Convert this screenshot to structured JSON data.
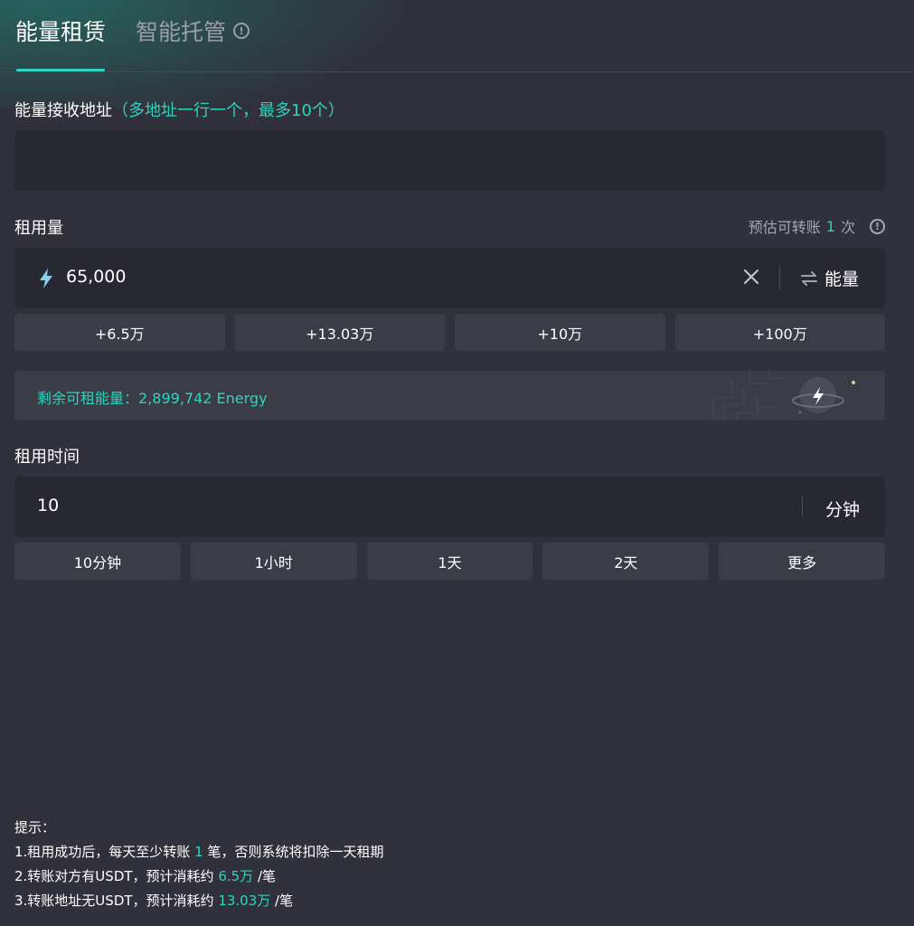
{
  "tabs": {
    "active": "能量租赁",
    "inactive": "智能托管",
    "info_icon": "info-circle-icon"
  },
  "address": {
    "label": "能量接收地址",
    "hint": "（多地址一行一个，最多10个）",
    "value": ""
  },
  "amount": {
    "label": "租用量",
    "estimate_prefix": "预估可转账",
    "estimate_count": "1",
    "estimate_suffix": "次",
    "value": "65,000",
    "unit": "能量",
    "icons": {
      "lead": "lightning-bolt-icon",
      "clear": "close-icon",
      "toggle": "swap-icon"
    },
    "quick": [
      "+6.5万",
      "+13.03万",
      "+10万",
      "+100万"
    ]
  },
  "remaining": {
    "label": "剩余可租能量：",
    "value": "2,899,742 Energy"
  },
  "duration": {
    "label": "租用时间",
    "value": "10",
    "unit": "分钟",
    "quick": [
      "10分钟",
      "1小时",
      "1天",
      "2天",
      "更多"
    ]
  },
  "tips": {
    "title": "提示：",
    "line1_pre": "1.租用成功后，每天至少转账",
    "line1_num": "1",
    "line1_post": "笔，否则系统将扣除一天租期",
    "line2_pre": "2.转账对方有USDT，预计消耗约",
    "line2_num": "6.5万",
    "line2_post": "/笔",
    "line3_pre": "3.转账地址无USDT，预计消耗约",
    "line3_num": "13.03万",
    "line3_post": "/笔"
  },
  "colors": {
    "accent": "#2dd4bf",
    "background": "#30313a",
    "input": "#272830",
    "chip": "#3a3c46"
  }
}
